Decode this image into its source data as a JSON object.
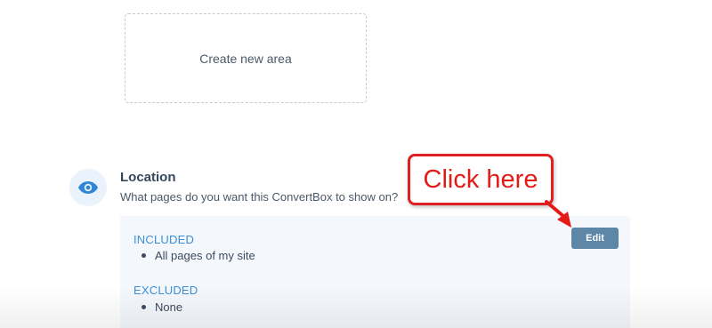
{
  "create_area": {
    "label": "Create new area"
  },
  "location": {
    "icon": "eye-icon",
    "title": "Location",
    "description": "What pages do you want this ConvertBox to show on?",
    "included": {
      "label": "INCLUDED",
      "items": [
        "All pages of my site"
      ]
    },
    "excluded": {
      "label": "EXCLUDED",
      "items": [
        "None"
      ]
    },
    "edit_label": "Edit"
  },
  "annotation": {
    "callout_text": "Click here",
    "color": "#e41b17"
  },
  "colors": {
    "accent": "#3b8fd9",
    "button": "#5e87a7",
    "panel_bg": "#f4f7fb"
  }
}
